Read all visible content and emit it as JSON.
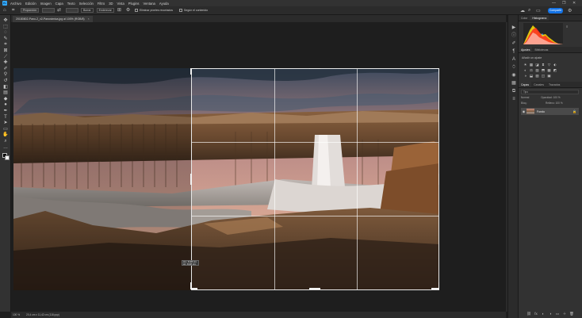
{
  "app": {
    "logo": "Ps"
  },
  "menu": [
    "Archivo",
    "Edición",
    "Imagen",
    "Capa",
    "Texto",
    "Selección",
    "Filtro",
    "3D",
    "Vista",
    "Plugins",
    "Ventana",
    "Ayuda"
  ],
  "window_controls": [
    "—",
    "❐",
    "✕"
  ],
  "options_bar": {
    "ratio_select": "Proporción",
    "swap_icon": "⇄",
    "clear_button": "Borrar",
    "straighten_button": "Enderezar",
    "delete_cropped_label": "Eliminar píxeles recortados",
    "content_aware_label": "Según el contenido",
    "share_button": "Compartir"
  },
  "document_tab": {
    "title": "20180802-Pano-2_v2-Panorámica.jpg al 100% (RGB/8)",
    "close": "×"
  },
  "tools": [
    {
      "name": "move-tool-icon",
      "glyph": "✥"
    },
    {
      "name": "marquee-tool-icon",
      "glyph": "⬚"
    },
    {
      "name": "lasso-tool-icon",
      "glyph": "◌"
    },
    {
      "name": "quick-select-tool-icon",
      "glyph": "✎"
    },
    {
      "name": "crop-tool-icon",
      "glyph": "⌗"
    },
    {
      "name": "frame-tool-icon",
      "glyph": "⊠"
    },
    {
      "name": "eyedropper-tool-icon",
      "glyph": "⟋"
    },
    {
      "name": "healing-tool-icon",
      "glyph": "✚"
    },
    {
      "name": "brush-tool-icon",
      "glyph": "✐"
    },
    {
      "name": "stamp-tool-icon",
      "glyph": "⚲"
    },
    {
      "name": "history-brush-tool-icon",
      "glyph": "↺"
    },
    {
      "name": "eraser-tool-icon",
      "glyph": "◧"
    },
    {
      "name": "gradient-tool-icon",
      "glyph": "▤"
    },
    {
      "name": "blur-tool-icon",
      "glyph": "◆"
    },
    {
      "name": "dodge-tool-icon",
      "glyph": "●"
    },
    {
      "name": "pen-tool-icon",
      "glyph": "✒"
    },
    {
      "name": "type-tool-icon",
      "glyph": "T"
    },
    {
      "name": "path-select-tool-icon",
      "glyph": "➤"
    },
    {
      "name": "shape-tool-icon",
      "glyph": "▭"
    },
    {
      "name": "hand-tool-icon",
      "glyph": "✋"
    },
    {
      "name": "zoom-tool-icon",
      "glyph": "⌕"
    },
    {
      "name": "more-tools-icon",
      "glyph": "…"
    }
  ],
  "crop_tooltip": {
    "line1": "An.: 8,38 cm",
    "line2": "Al.: 8,48 cm"
  },
  "status_bar": {
    "zoom": "100 %",
    "dimensions": "20,4 cm x 11,42 cm (118 ppp)"
  },
  "panel_strip_icons": [
    {
      "name": "play-icon",
      "glyph": "▶"
    },
    {
      "name": "info-icon",
      "glyph": "ⓘ"
    },
    {
      "name": "brush-settings-icon",
      "glyph": "✐"
    },
    {
      "name": "paragraph-icon",
      "glyph": "¶"
    },
    {
      "name": "character-icon",
      "glyph": "A"
    },
    {
      "name": "glyphs-icon",
      "glyph": "⍥"
    },
    {
      "name": "color-wheel-icon",
      "glyph": "◉"
    },
    {
      "name": "pattern-icon",
      "glyph": "▦"
    },
    {
      "name": "libraries-icon",
      "glyph": "⧉"
    },
    {
      "name": "properties-icon",
      "glyph": "≡"
    }
  ],
  "panels": {
    "top_tabs": [
      "Color",
      "Histograma"
    ],
    "adj_tabs": [
      "Ajustes",
      "Bibliotecas"
    ],
    "adj_label": "Añadir un ajuste",
    "adj_icons_row1": [
      "☀",
      "▦",
      "◪",
      "⧗",
      "▽",
      "⬖"
    ],
    "adj_icons_row2": [
      "◐",
      "⚖",
      "▧",
      "⬒",
      "▩",
      "◩"
    ],
    "adj_icons_row3": [
      "◑",
      "⬓",
      "▨",
      "◫",
      "▣"
    ],
    "layer_tabs": [
      "Capas",
      "Canales",
      "Trazados"
    ],
    "layer_filter": "Tipo",
    "layer_mode": "Normal",
    "layer_opacity": "Opacidad: 100 %",
    "layer_lock": "Bloq.:",
    "layer_fill": "Relleno: 100 %",
    "layer_name": "Fondo",
    "layer_bottom_icons": [
      "⛓",
      "fx",
      "◐",
      "◑",
      "▭",
      "＋",
      "🗑"
    ]
  },
  "colors": {
    "accent": "#1473e6",
    "bg": "#1e1e1e",
    "panel": "#323232"
  }
}
